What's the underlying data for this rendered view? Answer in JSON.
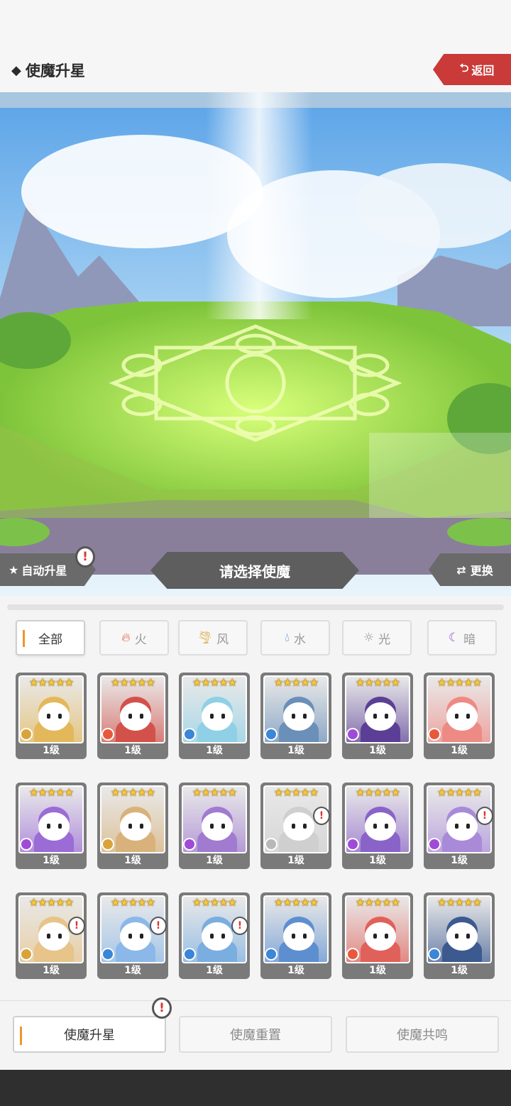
{
  "header": {
    "title": "使魔升星",
    "back_label": "返回"
  },
  "scene": {
    "auto_label": "自动升星",
    "select_label": "请选择使魔",
    "swap_label": "更换"
  },
  "filters": [
    {
      "label": "全部",
      "icon": "",
      "active": true
    },
    {
      "label": "火",
      "icon": "fire-icon",
      "active": false
    },
    {
      "label": "风",
      "icon": "wind-icon",
      "active": false
    },
    {
      "label": "水",
      "icon": "water-icon",
      "active": false
    },
    {
      "label": "光",
      "icon": "light-icon",
      "active": false
    },
    {
      "label": "暗",
      "icon": "dark-icon",
      "active": false
    }
  ],
  "cards": [
    {
      "stars": "★★★★★",
      "level": "1级",
      "element": "wind",
      "theme": "#e3b85a",
      "alert": false
    },
    {
      "stars": "★★★★★",
      "level": "1级",
      "element": "fire",
      "theme": "#d2514a",
      "alert": false
    },
    {
      "stars": "★★★★★",
      "level": "1级",
      "element": "water",
      "theme": "#8fd0e6",
      "alert": false
    },
    {
      "stars": "★★★★★",
      "level": "1级",
      "element": "water",
      "theme": "#6a8fb8",
      "alert": false
    },
    {
      "stars": "★★★★★",
      "level": "1级",
      "element": "dark",
      "theme": "#5b3f96",
      "alert": false
    },
    {
      "stars": "★★★★★",
      "level": "1级",
      "element": "fire",
      "theme": "#ee8a84",
      "alert": false
    },
    {
      "stars": "★★★★★",
      "level": "1级",
      "element": "dark",
      "theme": "#9b6bd6",
      "alert": false
    },
    {
      "stars": "★★★★★",
      "level": "1级",
      "element": "wind",
      "theme": "#d8b27a",
      "alert": false
    },
    {
      "stars": "★★★★★",
      "level": "1级",
      "element": "dark",
      "theme": "#a07bd0",
      "alert": false
    },
    {
      "stars": "★★★★★",
      "level": "1级",
      "element": "light",
      "theme": "#cfcfcf",
      "alert": true
    },
    {
      "stars": "★★★★★",
      "level": "1级",
      "element": "dark",
      "theme": "#8a63c8",
      "alert": false
    },
    {
      "stars": "★★★★★",
      "level": "1级",
      "element": "dark",
      "theme": "#a98ad8",
      "alert": true
    },
    {
      "stars": "★★★★★",
      "level": "1级",
      "element": "wind",
      "theme": "#e6c48a",
      "alert": true
    },
    {
      "stars": "★★★★★",
      "level": "1级",
      "element": "water",
      "theme": "#8bb8e8",
      "alert": true
    },
    {
      "stars": "★★★★★",
      "level": "1级",
      "element": "water",
      "theme": "#7aaee0",
      "alert": true
    },
    {
      "stars": "★★★★★",
      "level": "1级",
      "element": "water",
      "theme": "#5d8fd0",
      "alert": false
    },
    {
      "stars": "★★★★★",
      "level": "1级",
      "element": "fire",
      "theme": "#e0615a",
      "alert": false
    },
    {
      "stars": "★★★★★",
      "level": "1级",
      "element": "water",
      "theme": "#3c5a90",
      "alert": false
    }
  ],
  "tabs": [
    {
      "label": "使魔升星",
      "active": true,
      "alert": true
    },
    {
      "label": "使魔重置",
      "active": false,
      "alert": false
    },
    {
      "label": "使魔共鸣",
      "active": false,
      "alert": false
    }
  ],
  "colors": {
    "accent": "#f0942a",
    "back_button": "#c93a38",
    "star": "#f6c934",
    "fire": "#e8583a",
    "water": "#3a86d8",
    "wind": "#d8a43a",
    "light": "#b8b8b8",
    "dark": "#a04bd8"
  }
}
